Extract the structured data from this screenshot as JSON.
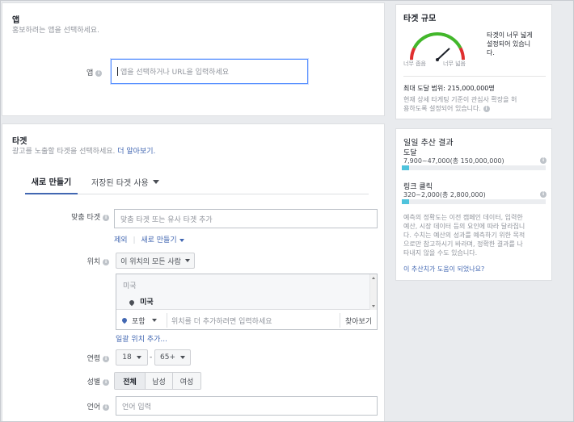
{
  "app_section": {
    "title": "앱",
    "subtitle": "홍보하려는 앱을 선택하세요.",
    "field_label": "앱",
    "placeholder": "앱을 선택하거나 URL을 입력하세요"
  },
  "audience_section": {
    "title": "타겟",
    "subtitle": "광고를 노출할 타겟을 선택하세요.",
    "learn_more": "더 알아보기.",
    "tabs": [
      {
        "label": "새로 만들기",
        "active": true
      },
      {
        "label": "저장된 타겟 사용",
        "active": false
      }
    ],
    "custom_audience": {
      "label": "맞춤 타겟",
      "placeholder": "맞춤 타겟 또는 유사 타겟 추가",
      "exclude": "제외",
      "create_new": "새로 만들기"
    },
    "location": {
      "label": "위치",
      "dropdown": "이 위치의 모든 사람",
      "country_header": "미국",
      "selected": "미국",
      "include_option": "포함",
      "search_placeholder": "위치를 더 추가하려면 입력하세요",
      "browse": "찾아보기",
      "bulk_add": "일괄 위치 추가..."
    },
    "age": {
      "label": "연령",
      "min": "18",
      "separator": "-",
      "max": "65+"
    },
    "gender": {
      "label": "성별",
      "options": [
        "전체",
        "남성",
        "여성"
      ],
      "selected": "전체"
    },
    "language": {
      "label": "언어",
      "placeholder": "언어 입력"
    }
  },
  "audience_size": {
    "title": "타겟 규모",
    "gauge_left": "너무 좁음",
    "gauge_right": "너무 넓음",
    "gauge_level": 0.72,
    "message_line1": "타겟이 너무 넓게",
    "message_line2": "설정되어 있습니",
    "message_line3": "다.",
    "potential_reach": "최대 도달 범위: 215,000,000명",
    "note_line1": "현재 상세 타게팅 기준이 관심사 확장을 허",
    "note_line2": "용하도록 설정되어 있습니다."
  },
  "daily_results": {
    "title": "일일 추산 결과",
    "reach_label": "도달",
    "reach_value": "7,900~47,000(총 150,000,000)",
    "reach_fraction": 0.05,
    "clicks_label": "링크 클릭",
    "clicks_value": "320~2,000(총 2,800,000)",
    "clicks_fraction": 0.05,
    "note_lines": [
      "예측의 정확도는 이전 캠페인 데이터, 입력한",
      "예산, 시장 데이터 등의 요인에 따라 달라집니",
      "다. 수치는 예산의 성과를 예측하기 위한 목적",
      "으로만 참고하시기 바라며, 정확한 결과를 나",
      "타내지 않을 수도 있습니다."
    ],
    "feedback_link": "이 추산치가 도움이 되었나요?"
  },
  "colors": {
    "accent": "#4267b2",
    "input_focus": "#5890ff",
    "gauge_red": "#e02f2f",
    "gauge_green": "#42b72a",
    "bar_fill": "#4fc3dc"
  }
}
